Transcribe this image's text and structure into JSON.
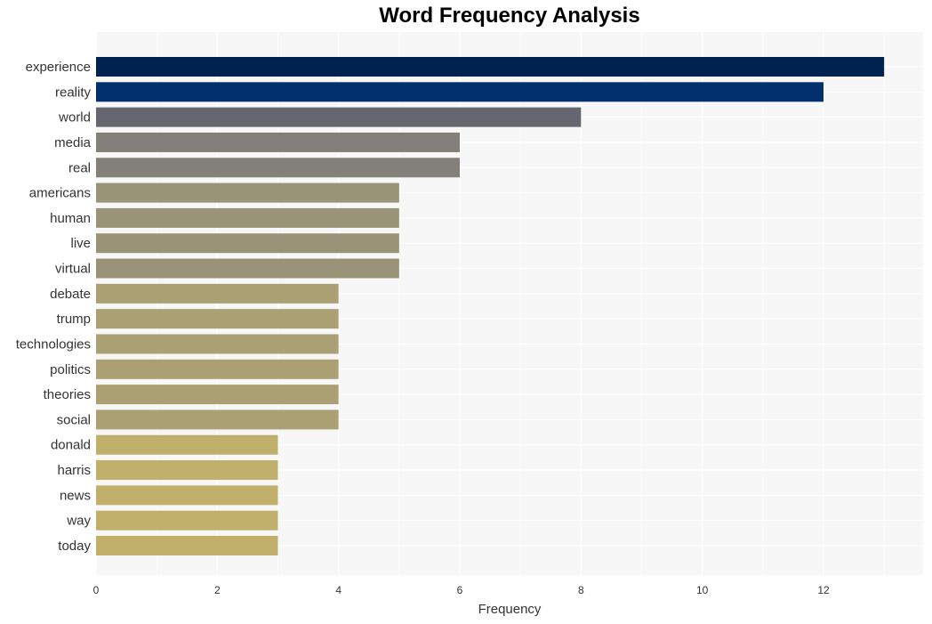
{
  "chart_data": {
    "type": "bar",
    "orientation": "horizontal",
    "title": "Word Frequency Analysis",
    "xlabel": "Frequency",
    "ylabel": "",
    "xlim": [
      0,
      13.6
    ],
    "xticks": [
      0,
      2,
      4,
      6,
      8,
      10,
      12
    ],
    "grid": true,
    "categories": [
      "experience",
      "reality",
      "world",
      "media",
      "real",
      "americans",
      "human",
      "live",
      "virtual",
      "debate",
      "trump",
      "technologies",
      "politics",
      "theories",
      "social",
      "donald",
      "harris",
      "news",
      "way",
      "today"
    ],
    "values": [
      13,
      12,
      8,
      6,
      6,
      5,
      5,
      5,
      5,
      4,
      4,
      4,
      4,
      4,
      4,
      3,
      3,
      3,
      3,
      3
    ],
    "colors": [
      "#00224e",
      "#01306f",
      "#666670",
      "#838079",
      "#838079",
      "#999378",
      "#999378",
      "#999378",
      "#999378",
      "#aba074",
      "#aba074",
      "#aba074",
      "#aba074",
      "#aba074",
      "#aba074",
      "#c1b06c",
      "#c1b06c",
      "#c1b06c",
      "#c1b06c",
      "#c1b06c"
    ],
    "background": "#f7f7f7"
  }
}
